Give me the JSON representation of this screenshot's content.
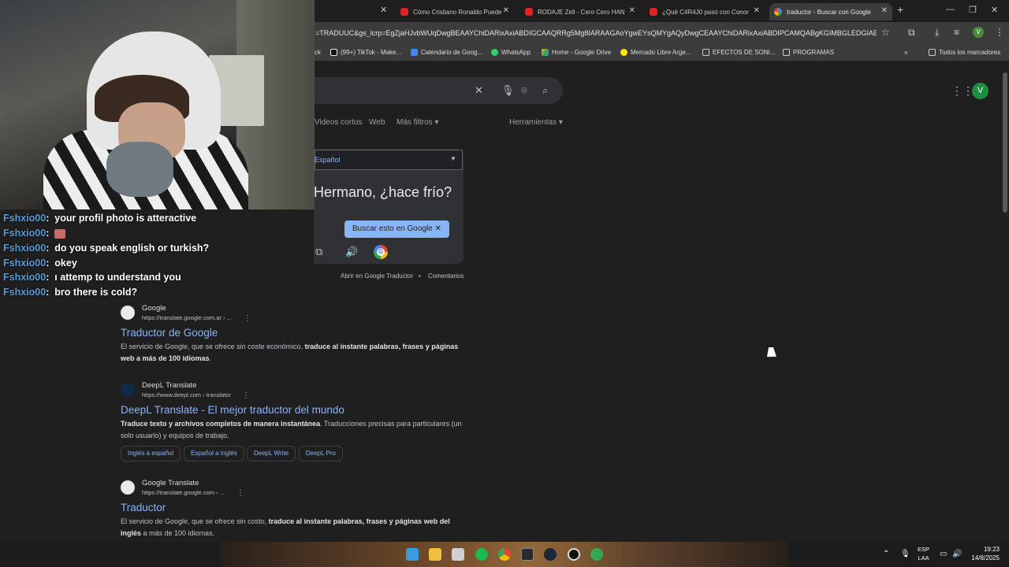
{
  "browser": {
    "tabs": [
      {
        "title": "Cómo Cristiano Ronaldo Puede",
        "icon": "youtube-icon"
      },
      {
        "title": "RODAJE Zell - Cero Cero HAN",
        "icon": "youtube-icon"
      },
      {
        "title": "¿Qué C4R4J0 pasó con Conor",
        "icon": "youtube-icon"
      },
      {
        "title": "traductor - Buscar con Google",
        "icon": "google-icon",
        "active": true
      }
    ],
    "url": "=TRADUUC&gs_lcrp=EgZjaHJvbWUqDwgBEAAYChiDARixAxiABDIGCAAQRRg5Mg8IARAAGAoYgwEYsQMYgAQyDwgCEAAYChiDARixAxiABDIPCAMQABgKGIMBGLEDGIAEMg",
    "profile_initial": "V",
    "bookmarks": [
      "ck",
      "(99+) TikTok - Make...",
      "Calendario de Goog...",
      "WhatsApp",
      "Home - Google Drive",
      "Mercado Libre Arge...",
      "EFECTOS DE SONI...",
      "PROGRAMAS",
      "Todos los marcadores"
    ]
  },
  "google": {
    "account_initial": "V",
    "nav_tabs": [
      "Videos cortos",
      "Web",
      "Más filtros",
      "Herramientas"
    ],
    "translator": {
      "target_language": "Español",
      "translated_text": "Hermano, ¿hace frío?",
      "search_chip": "Buscar esto en Google",
      "open_link": "Abrir en Google Traductor",
      "feedback_link": "Comentarios",
      "separator": "•"
    },
    "results": [
      {
        "site": "Google",
        "url": "https://translate.google.com.ar › ...",
        "title": "Traductor de Google",
        "snippet_plain": "El servicio de Google, que se ofrece sin coste económico, ",
        "snippet_bold": "traduce al instante palabras, frases y páginas web a más de 100 idiomas",
        "snippet_end": "."
      },
      {
        "site": "DeepL Translate",
        "url": "https://www.deepl.com › translator",
        "title": "DeepL Translate - El mejor traductor del mundo",
        "snippet_bold": "Traduce texto y archivos completos de manera instantánea",
        "snippet_plain": ". Traducciones precisas para particulares (un solo usuario) y equipos de trabajo.",
        "chips": [
          "Inglés a español",
          "Español a inglés",
          "DeepL Write",
          "DeepL Pro"
        ]
      },
      {
        "site": "Google Translate",
        "url": "https://translate.google.com › ...",
        "title": "Traductor",
        "snippet_plain": "El servicio de Google, que se ofrece sin costo, ",
        "snippet_bold": "traduce al instante palabras, frases y páginas web del inglés",
        "snippet_end": " a más de 100 idiomas."
      }
    ]
  },
  "chat": [
    {
      "user": "Fshxio00",
      "message": "your profil photo is atteractive"
    },
    {
      "user": "Fshxio00",
      "message": "",
      "emote": "emote-icon"
    },
    {
      "user": "Fshxio00",
      "message": "do you speak english or turkish?"
    },
    {
      "user": "Fshxio00",
      "message": "okey"
    },
    {
      "user": "Fshxio00",
      "message": "ı attemp to understand you"
    },
    {
      "user": "Fshxio00",
      "message": "bro there is cold?"
    }
  ],
  "taskbar": {
    "language_line1": "ESP",
    "language_line2": "LAA",
    "time": "19:23",
    "date": "14/8/2025"
  }
}
